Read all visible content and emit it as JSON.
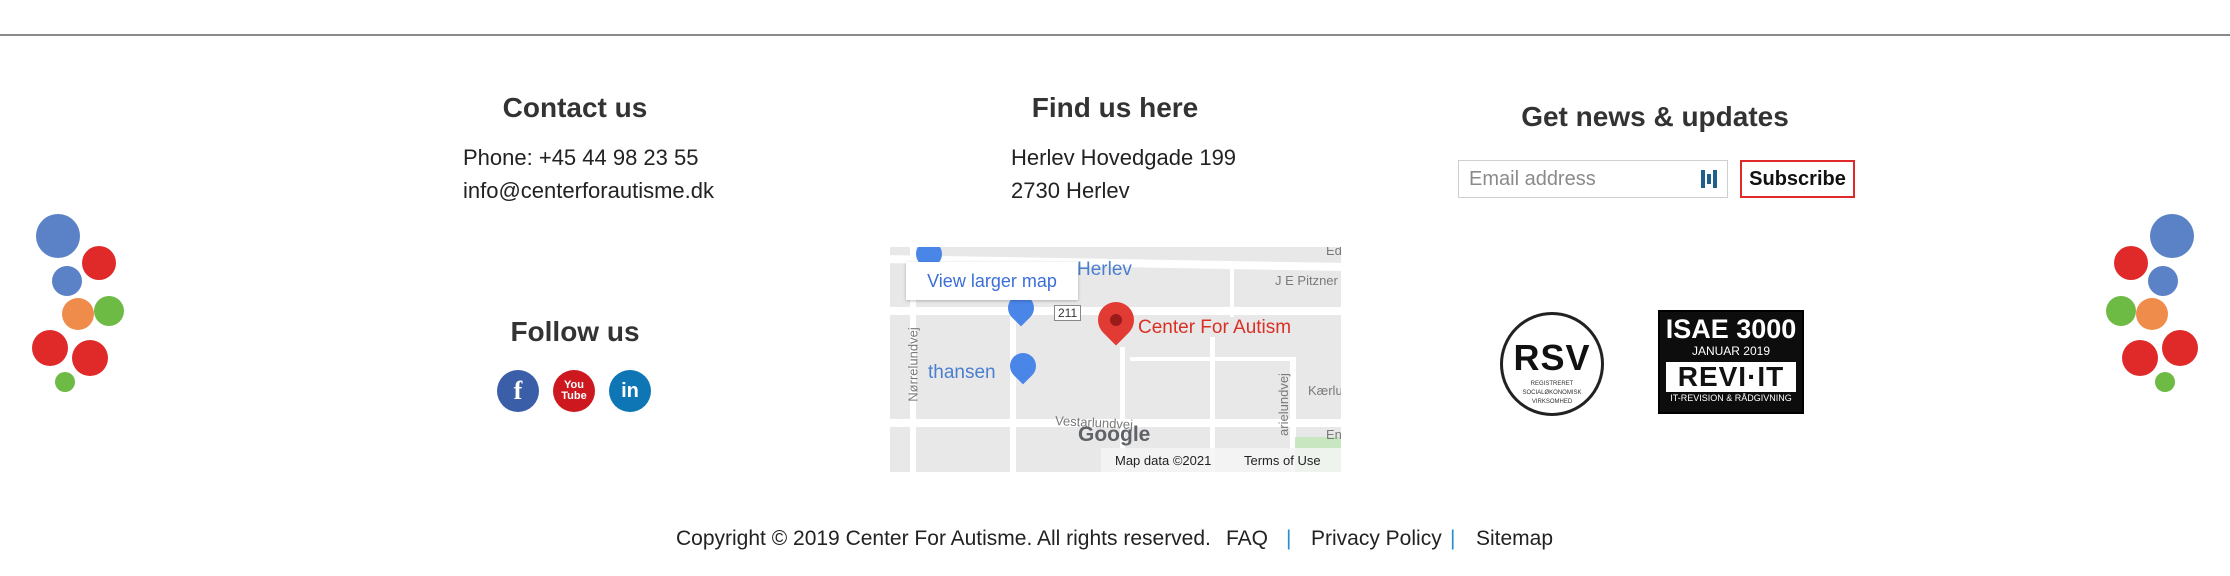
{
  "contact": {
    "heading": "Contact us",
    "phone": "Phone: +45 44 98 23 55",
    "email": "info@centerforautisme.dk"
  },
  "find": {
    "heading": "Find us here",
    "address_line1": "Herlev Hovedgade 199",
    "address_line2": "2730 Herlev"
  },
  "news": {
    "heading": "Get news & updates",
    "email_placeholder": "Email address",
    "subscribe_label": "Subscribe"
  },
  "follow": {
    "heading": "Follow us",
    "networks": [
      "facebook",
      "youtube",
      "linkedin"
    ],
    "facebook_glyph": "f",
    "youtube_glyph_top": "You",
    "youtube_glyph_bottom": "Tube",
    "linkedin_glyph": "in"
  },
  "map": {
    "view_larger": "View larger map",
    "pin_label": "Center For Autism",
    "place_herlev": "Herlev",
    "place_thansen": "thansen",
    "road_211": "211",
    "road_pitzner": "J E Pitzner",
    "road_norrelundvej": "Nørrelundvej",
    "road_vestarlundvej": "Vestarlundvej",
    "road_kaerlu": "Kærlu",
    "road_arielundvej": "arielundvej",
    "road_en": "En",
    "road_ed": "Ed",
    "brand": "Google",
    "map_data": "Map data ©2021",
    "terms": "Terms of Use"
  },
  "badges": {
    "rsv_main": "RSV",
    "rsv_sub1": "REGISTRERET",
    "rsv_sub2": "SOCIALØKONOMISK",
    "rsv_sub3": "VIRKSOMHED",
    "isae_main": "ISAE 3000",
    "isae_date": "JANUAR 2019",
    "isae_revi": "REVI·IT",
    "isae_foot": "IT-REVISION & RÅDGIVNING"
  },
  "footer": {
    "copyright": "Copyright © 2019 Center For Autisme. All rights reserved.",
    "faq": "FAQ",
    "privacy": "Privacy Policy",
    "sitemap": "Sitemap",
    "separator": "|"
  },
  "colors": {
    "accent_red": "#e02a2a",
    "link_blue": "#2a8fd0",
    "dot_blue": "#5b82c6",
    "dot_orange": "#ef8c4b",
    "dot_green": "#6dbb45"
  }
}
